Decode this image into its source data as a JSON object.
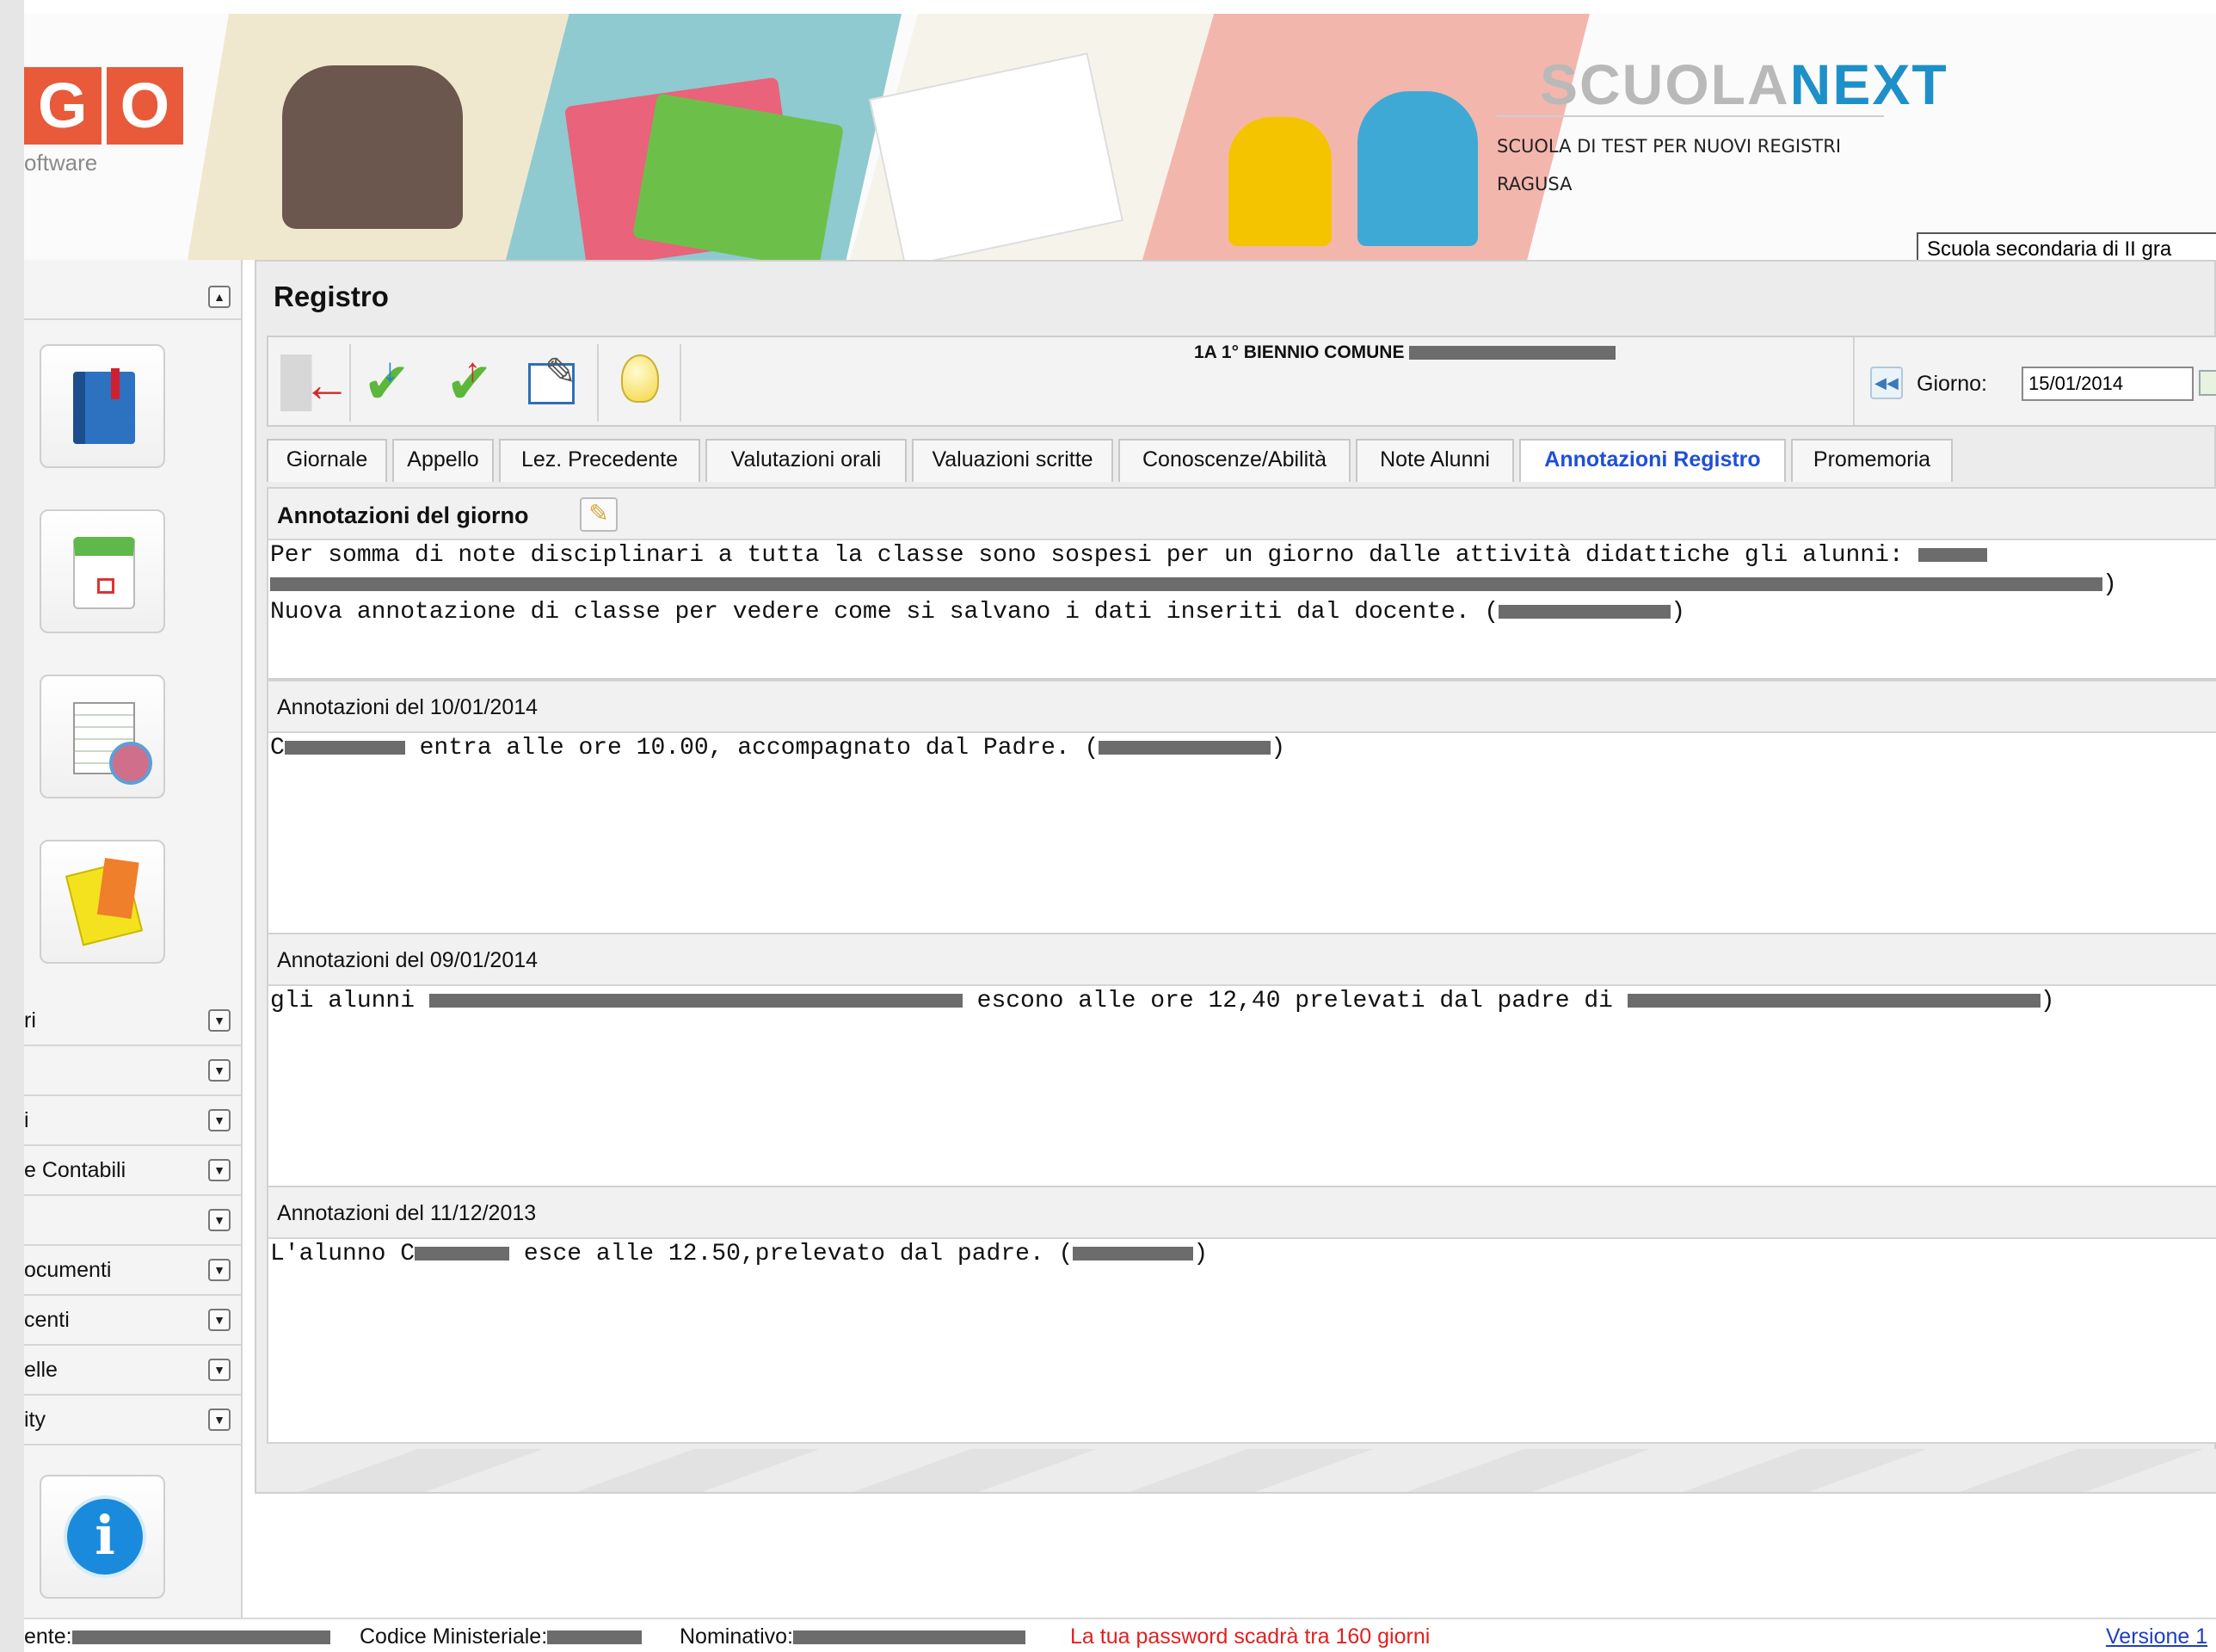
{
  "header": {
    "logo_letters": [
      "G",
      "O"
    ],
    "logo_sub": "oftware",
    "brand_part1": "SCUOLA",
    "brand_part2": "NEXT",
    "school_name": "SCUOLA DI TEST PER NUOVI REGISTRI",
    "school_city": "RAGUSA",
    "school_type": "Scuola secondaria di II gra"
  },
  "sidebar": {
    "collapse_symbol": "▲",
    "expand_symbol": "▼",
    "quick_icons": [
      "register-book-icon",
      "calendar-icon",
      "spreadsheet-chart-icon",
      "cards-whistle-icon"
    ],
    "info_glyph": "i",
    "menu_items": [
      {
        "label": "ri"
      },
      {
        "label": ""
      },
      {
        "label": "i"
      },
      {
        "label": "e Contabili"
      },
      {
        "label": ""
      },
      {
        "label": "ocumenti"
      },
      {
        "label": "centi"
      },
      {
        "label": "elle"
      },
      {
        "label": "ity"
      }
    ]
  },
  "main": {
    "title": "Registro",
    "class_label": "1A 1° BIENNIO COMUNE",
    "day_label": "Giorno:",
    "day_value": "15/01/2014",
    "prev_symbol": "◀◀",
    "tabs": [
      {
        "label": "Giornale",
        "active": false
      },
      {
        "label": "Appello",
        "active": false
      },
      {
        "label": "Lez. Precedente",
        "active": false
      },
      {
        "label": "Valutazioni orali",
        "active": false
      },
      {
        "label": "Valuazioni scritte",
        "active": false
      },
      {
        "label": "Conoscenze/Abilità",
        "active": false
      },
      {
        "label": "Note Alunni",
        "active": false
      },
      {
        "label": "Annotazioni Registro",
        "active": true
      },
      {
        "label": "Promemoria",
        "active": false
      }
    ],
    "today": {
      "title": "Annotazioni del giorno",
      "line1": "Per somma di note disciplinari a tutta la classe sono sospesi per un giorno dalle attività didattiche gli alunni:",
      "line2_end": ")",
      "line3": "Nuova annotazione di classe per vedere come si salvano i dati inseriti dal docente. (",
      "line3_end": ")"
    },
    "sections": [
      {
        "title": "Annotazioni del 10/01/2014",
        "pre": "C",
        "text": " entra alle ore 10.00, accompagnato dal Padre. (",
        "end": ")"
      },
      {
        "title": "Annotazioni del 09/01/2014",
        "pre": "gli alunni ",
        "text": " escono alle ore 12,40 prelevati dal padre di ",
        "end": ")"
      },
      {
        "title": "Annotazioni del 11/12/2013",
        "pre": "L'alunno C",
        "text": " esce alle 12.50,prelevato dal padre. (",
        "end": ")"
      }
    ]
  },
  "footer": {
    "user_prefix": "ente:",
    "codice_label": "Codice Ministeriale:",
    "nominativo_label": "Nominativo:",
    "password_warning": "La tua password scadrà tra 160 giorni",
    "version_label": "Versione 1"
  },
  "colors": {
    "active_tab": "#1f4fd8",
    "warning": "#e12020",
    "brand_blue": "#1e90c9",
    "link": "#1f3fbf"
  }
}
